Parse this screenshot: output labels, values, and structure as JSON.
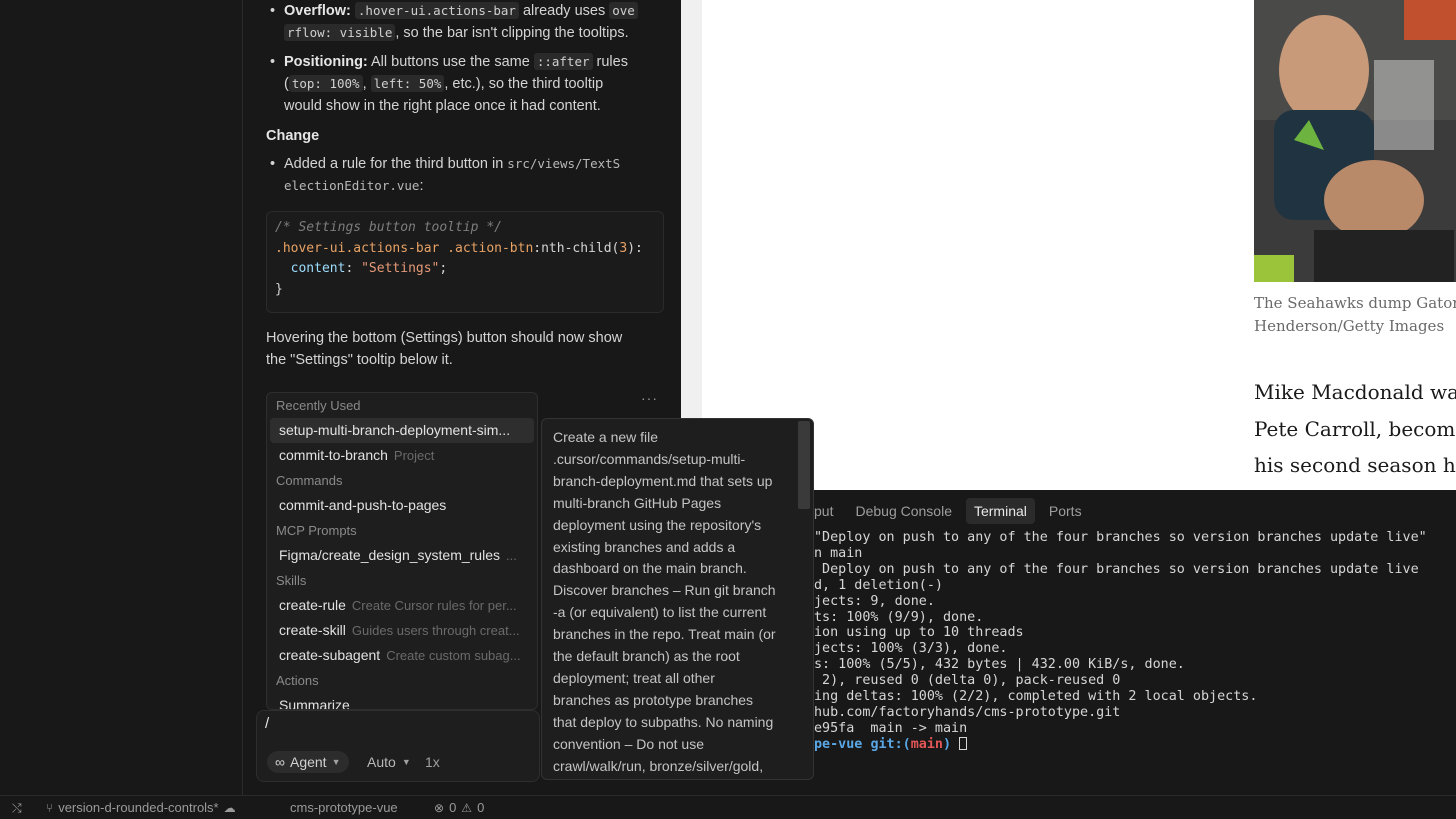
{
  "chat": {
    "bullets_top": [
      {
        "label": "Overflow:",
        "code1": ".hover-ui.actions-bar",
        "mid": " already uses ",
        "code2": "ove",
        "code2b": "rflow: visible",
        "tail": ", so the bar isn't clipping the tooltips."
      },
      {
        "label": "Positioning:",
        "text1": " All buttons use the same ",
        "code1": "::after",
        "text2": " rules",
        "paren_open": "(",
        "code2": "top: 100%",
        "comma": ", ",
        "code3": "left: 50%",
        "text3": ", etc.), so the third tooltip",
        "text4": "would show in the right place once it had content."
      }
    ],
    "change_heading": "Change",
    "change_bullet": {
      "text": "Added a rule for the third button in ",
      "path1": "src/views/TextS",
      "path2": "electionEditor.vue",
      "colon": ":"
    },
    "code": {
      "line1": "/* Settings button tooltip */",
      "line2_sel": ".hover-ui.actions-bar .action-btn",
      "line2_pseudo": ":nth-child(",
      "line2_num": "3",
      "line2_end": "):",
      "line3_prop": "  content",
      "line3_colon": ": ",
      "line3_str": "\"Settings\"",
      "line3_semi": ";",
      "line4": "}"
    },
    "closing_para_1": "Hovering the bottom (Settings) button should now show",
    "closing_para_2": "the \"Settings\" tooltip below it.",
    "more": "···"
  },
  "command_menu": {
    "sections": [
      {
        "title": "Recently Used",
        "items": [
          {
            "label": "setup-multi-branch-deployment-sim...",
            "desc": "",
            "active": true
          },
          {
            "label": "commit-to-branch",
            "desc": "Project"
          }
        ]
      },
      {
        "title": "Commands",
        "items": [
          {
            "label": "commit-and-push-to-pages",
            "desc": ""
          }
        ]
      },
      {
        "title": "MCP Prompts",
        "items": [
          {
            "label": "Figma/create_design_system_rules",
            "desc": "..."
          }
        ]
      },
      {
        "title": "Skills",
        "items": [
          {
            "label": "create-rule",
            "desc": "Create Cursor rules for per..."
          },
          {
            "label": "create-skill",
            "desc": "Guides users through creat..."
          },
          {
            "label": "create-subagent",
            "desc": "Create custom subag..."
          }
        ]
      },
      {
        "title": "Actions",
        "items": [
          {
            "label": "Summarize",
            "desc": ""
          }
        ]
      }
    ]
  },
  "doc_popup": {
    "lines": [
      "Create a new file",
      ".cursor/commands/setup-multi-",
      "branch-deployment.md that sets up",
      "multi-branch GitHub Pages",
      "deployment using the repository's",
      "existing branches and adds a",
      "dashboard on the main branch.",
      "Discover branches – Run git branch",
      "-a (or equivalent) to list the current",
      "branches in the repo. Treat main (or",
      "the default branch) as the root",
      "deployment; treat all other",
      "branches as prototype branches",
      "that deploy to subpaths. No naming",
      "convention – Do not use",
      "crawl/walk/run, bronze/silver/gold,"
    ]
  },
  "input": {
    "value": "/",
    "agent_label": "Agent",
    "model_label": "Auto",
    "multiplier": "1x"
  },
  "browser": {
    "caption_line1": "The Seahawks dump Gator",
    "caption_line2": "Henderson/Getty Images",
    "article_lines": [
      "Mike Macdonald was",
      "Pete Carroll, becomin",
      "his second season he"
    ]
  },
  "panel": {
    "tabs": [
      "put",
      "Debug Console",
      "Terminal",
      "Ports"
    ],
    "active_tab": "Terminal",
    "terminal_lines": [
      "\"Deploy on push to any of the four branches so version branches update live\"",
      "n main",
      " Deploy on push to any of the four branches so version branches update live",
      "d, 1 deletion(-)",
      "jects: 9, done.",
      "ts: 100% (9/9), done.",
      "ion using up to 10 threads",
      "jects: 100% (3/3), done.",
      "s: 100% (5/5), 432 bytes | 432.00 KiB/s, done.",
      " 2), reused 0 (delta 0), pack-reused 0",
      "ing deltas: 100% (2/2), completed with 2 local objects.",
      "hub.com/factoryhands/cms-prototype.git",
      "e95fa  main -> main"
    ],
    "prompt_dir": "pe-vue",
    "prompt_git": "git:(",
    "prompt_branch": "main",
    "prompt_close": ")"
  },
  "status_bar": {
    "branch": "version-d-rounded-controls*",
    "project": "cms-prototype-vue",
    "errors": "0",
    "warnings": "0"
  }
}
